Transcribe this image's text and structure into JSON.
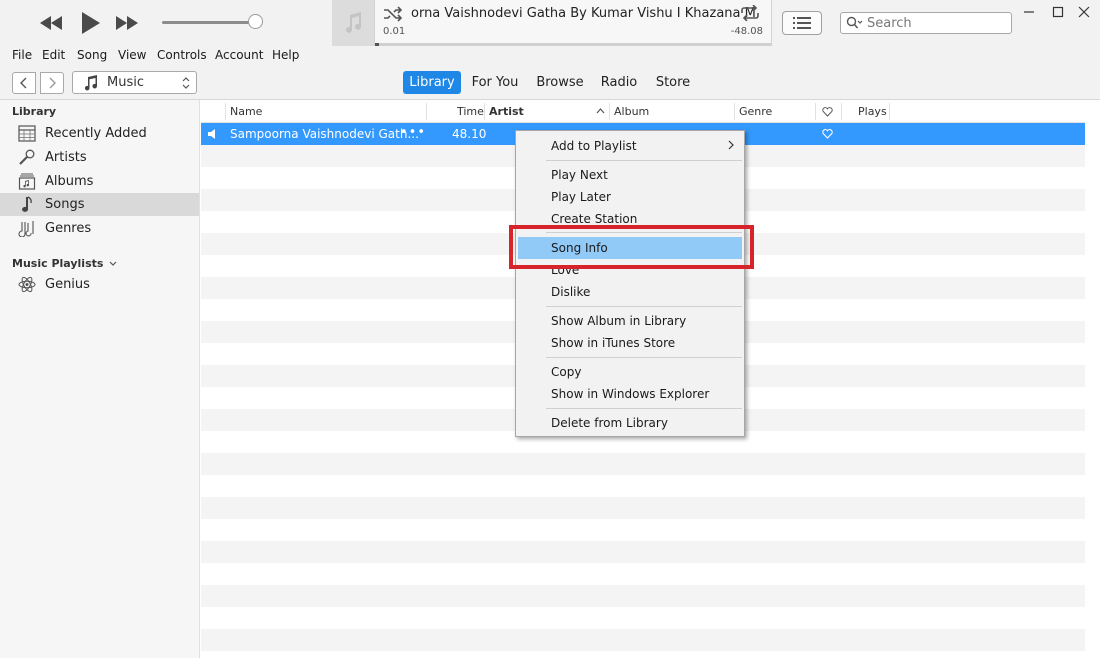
{
  "player": {
    "now_playing_title": "orna Vaishnodevi Gatha By Kumar Vishu I Khazana M",
    "elapsed": "0.01",
    "remaining": "-48.08",
    "progress_fraction": 0.01,
    "volume_fraction": 0.9
  },
  "search": {
    "placeholder": "Search"
  },
  "menubar": [
    "File",
    "Edit",
    "Song",
    "View",
    "Controls",
    "Account",
    "Help"
  ],
  "nav": {
    "media_kind": "Music",
    "tabs": [
      "Library",
      "For You",
      "Browse",
      "Radio",
      "Store"
    ],
    "active_tab": "Library"
  },
  "sidebar": {
    "library_header": "Library",
    "items": [
      "Recently Added",
      "Artists",
      "Albums",
      "Songs",
      "Genres"
    ],
    "selected": "Songs",
    "playlists_header": "Music Playlists",
    "playlists": [
      "Genius"
    ]
  },
  "columns": [
    "Name",
    "Time",
    "Artist",
    "Album",
    "Genre",
    "Plays"
  ],
  "songs": [
    {
      "name": "Sampoorna Vaishnodevi Gath...",
      "time": "48.10",
      "more": "•••"
    }
  ],
  "context_menu": {
    "items": [
      "Add to Playlist",
      "Play Next",
      "Play Later",
      "Create Station",
      "Song Info",
      "Love",
      "Dislike",
      "Show Album in Library",
      "Show in iTunes Store",
      "Copy",
      "Show in Windows Explorer",
      "Delete from Library"
    ],
    "highlighted": "Song Info"
  },
  "colors": {
    "accent": "#1f87e5",
    "selection_row": "#3399ff",
    "menu_highlight": "#91c9f7",
    "annotation_box": "#d7242a"
  }
}
